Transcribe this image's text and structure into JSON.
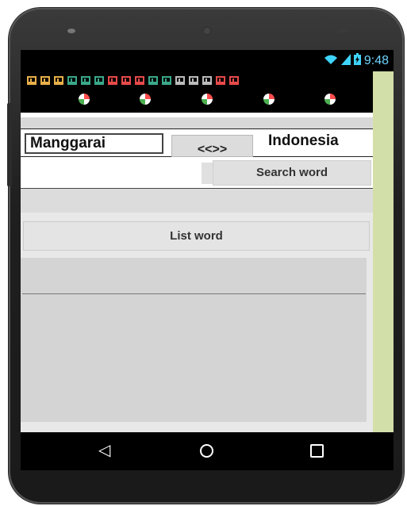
{
  "statusbar": {
    "time": "9:48",
    "wifi_icon": "wifi-icon",
    "signal_icon": "signal-icon",
    "battery_icon": "battery-charging-icon"
  },
  "banner": {
    "motif_colors": [
      "#e8b04a",
      "#e8b04a",
      "#e8b04a",
      "#3aa88a",
      "#3aa88a",
      "#3aa88a",
      "#e84a4a",
      "#e84a4a",
      "#e84a4a",
      "#3aa88a",
      "#3aa88a",
      "#bbbbbb",
      "#bbbbbb",
      "#bbbbbb",
      "#e84a4a",
      "#e84a4a"
    ],
    "rosette_count": 5
  },
  "language": {
    "source": "Manggarai",
    "swap_label": "<<>>",
    "target": "Indonesia"
  },
  "search": {
    "value": "",
    "placeholder": "",
    "button_label": "Search word"
  },
  "list": {
    "button_label": "List word",
    "items": []
  },
  "navigation": {
    "back_icon": "back-triangle-icon",
    "home_icon": "home-circle-icon",
    "recents_icon": "recents-square-icon"
  },
  "colors": {
    "accent_strip": "#d2dfa8",
    "status_text": "#6fd6ff"
  }
}
